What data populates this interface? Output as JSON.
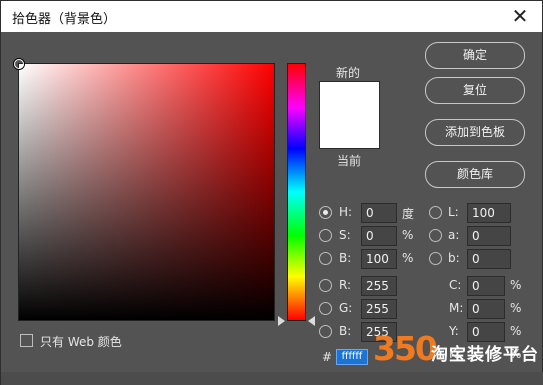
{
  "window": {
    "title": "拾色器（背景色）"
  },
  "labels": {
    "new": "新的",
    "current": "当前"
  },
  "buttons": {
    "ok": "确定",
    "reset": "复位",
    "add_to_swatches": "添加到色板",
    "color_libraries": "颜色库"
  },
  "fields": {
    "H": {
      "label": "H:",
      "value": "0",
      "unit": "度",
      "selected": true
    },
    "S": {
      "label": "S:",
      "value": "0",
      "unit": "%"
    },
    "B": {
      "label": "B:",
      "value": "100",
      "unit": "%"
    },
    "R": {
      "label": "R:",
      "value": "255"
    },
    "G": {
      "label": "G:",
      "value": "255"
    },
    "Bl": {
      "label": "B:",
      "value": "255"
    },
    "L": {
      "label": "L:",
      "value": "100"
    },
    "a": {
      "label": "a:",
      "value": "0"
    },
    "b": {
      "label": "b:",
      "value": "0"
    },
    "C": {
      "label": "C:",
      "value": "0",
      "unit": "%"
    },
    "M": {
      "label": "M:",
      "value": "0",
      "unit": "%"
    },
    "Y": {
      "label": "Y:",
      "value": "0",
      "unit": "%"
    },
    "K": {
      "label": "K:",
      "value": "",
      "unit": "%"
    }
  },
  "hex": {
    "prefix": "#",
    "value": "ffffff"
  },
  "web_only": {
    "label": "只有 Web 颜色"
  },
  "colors": {
    "current": "#ffffff",
    "new": "#ffffff",
    "hue": "#ff0000",
    "dialog_bg": "#535353"
  },
  "watermark": {
    "num": "350",
    "text": "淘宝装修平台"
  }
}
